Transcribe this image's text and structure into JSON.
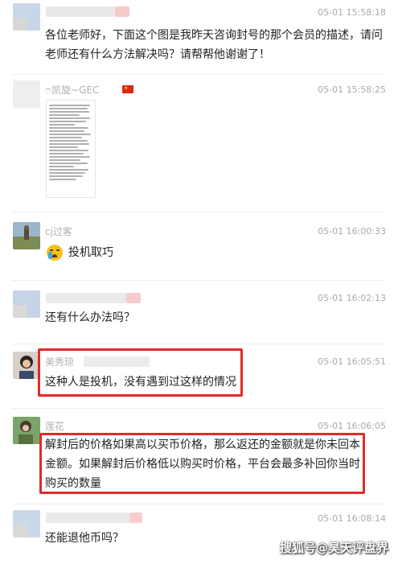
{
  "messages": [
    {
      "sender": "",
      "time": "05-01 15:58:18",
      "text": "各位老师好，下面这个图是我昨天咨询封号的那个会员的描述，请问老师还有什么方法解决吗？请帮帮他谢谢了！"
    },
    {
      "sender": "ෆ凯旋~GEC",
      "time": "05-01 15:58:25"
    },
    {
      "sender": "cj过客",
      "time": "05-01 16:00:33",
      "emoji_icon": "crying-face-icon",
      "text": "投机取巧"
    },
    {
      "sender": "",
      "time": "05-01 16:02:13",
      "text": "还有什么办法吗？"
    },
    {
      "sender": "美秀琼",
      "time": "05-01 16:05:51",
      "text": "这种人是投机，没有遇到过这样的情况"
    },
    {
      "sender": "莲花",
      "time": "05-01 16:06:05",
      "text": "解封后的价格如果高以买币价格，那么返还的金额就是你未回本金额。如果解封后价格低以购买时价格，平台会最多补回你当时购买的数量"
    },
    {
      "sender": "",
      "time": "05-01 16:08:14",
      "text": "还能退他币吗？"
    }
  ],
  "watermark": "搜狐号@昊天评盘界",
  "colors": {
    "highlight": "#e02b2b",
    "meta": "#aaaaaa"
  }
}
